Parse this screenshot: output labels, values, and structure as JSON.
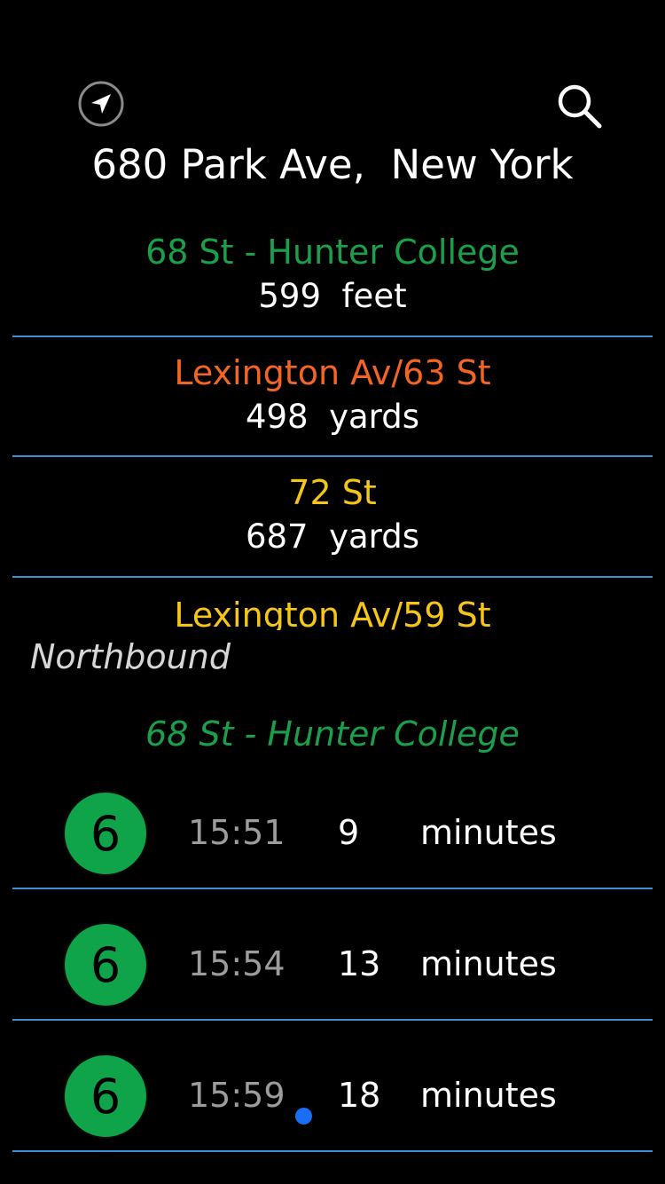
{
  "header": {
    "location_icon": "location-arrow-icon",
    "search_icon": "search-icon",
    "address": "680 Park Ave,  New York"
  },
  "nearby_stations": [
    {
      "name": "68 St - Hunter College",
      "distance": "599  feet",
      "color": "#1aa04a"
    },
    {
      "name": "Lexington Av/63 St",
      "distance": "498  yards",
      "color": "#f26522"
    },
    {
      "name": "72 St",
      "distance": "687  yards",
      "color": "#f5c518"
    },
    {
      "name": "Lexington Av/59 St",
      "color": "#f5c518"
    }
  ],
  "arrivals": {
    "direction": "Northbound",
    "station": "68 St - Hunter College",
    "station_color": "#1aa04a",
    "trains": [
      {
        "route": "6",
        "time": "15:51",
        "minutes": "9",
        "unit": "minutes",
        "route_color": "#0fa34a"
      },
      {
        "route": "6",
        "time": "15:54",
        "minutes": "13",
        "unit": "minutes",
        "route_color": "#0fa34a"
      },
      {
        "route": "6",
        "time": "15:59",
        "minutes": "18",
        "unit": "minutes",
        "route_color": "#0fa34a"
      }
    ]
  },
  "colors": {
    "separator": "#3a8fd6",
    "live_dot": "#1a6ef5"
  }
}
